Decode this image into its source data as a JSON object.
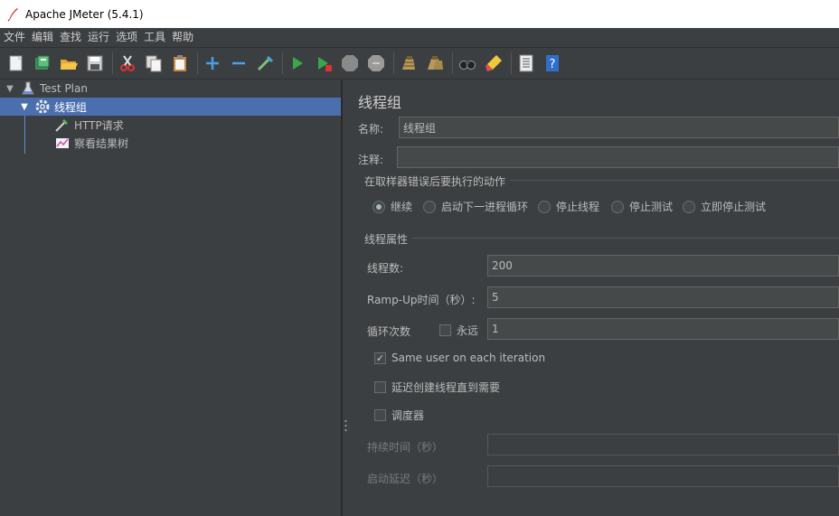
{
  "window": {
    "title": "Apache JMeter (5.4.1)"
  },
  "menu": [
    "文件",
    "编辑",
    "查找",
    "运行",
    "选项",
    "工具",
    "帮助"
  ],
  "toolbar": {
    "icons": [
      "new-icon",
      "templates-icon",
      "open-icon",
      "save-icon",
      "cut-icon",
      "copy-icon",
      "paste-icon",
      "expand-icon",
      "collapse-icon",
      "toggle-icon",
      "start-icon",
      "start-no-pause-icon",
      "stop-icon",
      "shutdown-icon",
      "clear-icon",
      "clear-all-icon",
      "search-icon",
      "reset-search-icon",
      "function-helper-icon",
      "help-icon"
    ]
  },
  "tree": {
    "items": [
      {
        "label": "Test Plan",
        "icon": "test-plan-icon"
      },
      {
        "label": "线程组",
        "icon": "gear-icon"
      },
      {
        "label": "HTTP请求",
        "icon": "sampler-pipette-icon"
      },
      {
        "label": "察看结果树",
        "icon": "listener-chart-icon"
      }
    ]
  },
  "form": {
    "title": "线程组",
    "name_label": "名称:",
    "name_value": "线程组",
    "comment_label": "注释:",
    "comment_value": "",
    "action_group_title": "在取样器错误后要执行的动作",
    "actions": [
      {
        "label": "继续",
        "selected": true
      },
      {
        "label": "启动下一进程循环",
        "selected": false
      },
      {
        "label": "停止线程",
        "selected": false
      },
      {
        "label": "停止测试",
        "selected": false
      },
      {
        "label": "立即停止测试",
        "selected": false
      }
    ],
    "props_group_title": "线程属性",
    "threads_label": "线程数:",
    "threads_value": "200",
    "rampup_label": "Ramp-Up时间（秒）:",
    "rampup_value": "5",
    "loop_label": "循环次数",
    "forever_label": "永远",
    "forever_checked": false,
    "loop_value": "1",
    "same_user_label": "Same user on each iteration",
    "same_user_checked": true,
    "delay_label": "延迟创建线程直到需要",
    "delay_checked": false,
    "scheduler_label": "调度器",
    "scheduler_checked": false,
    "duration_label": "持续时间（秒）",
    "duration_value": "",
    "startup_delay_label": "启动延迟（秒）",
    "startup_delay_value": ""
  },
  "colors": {
    "background": "#3c3f41",
    "selection": "#4b6eaf",
    "field": "#45494a"
  }
}
